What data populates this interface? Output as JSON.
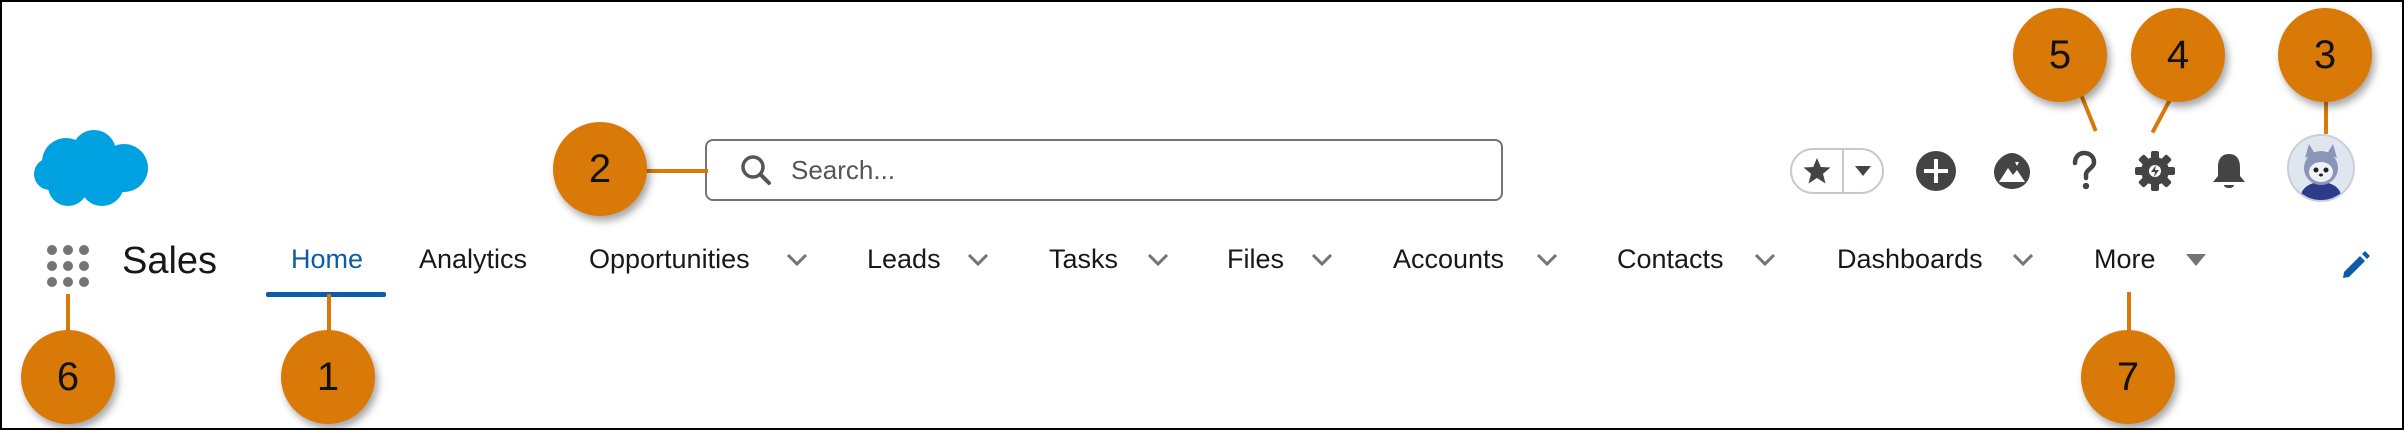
{
  "header": {
    "search_placeholder": "Search...",
    "icons": [
      "salesforce-cloud-logo",
      "search-icon",
      "star-icon",
      "chevron-down-icon",
      "plus-icon",
      "trailhead-icon",
      "help-icon",
      "gear-icon",
      "bell-icon",
      "avatar"
    ]
  },
  "nav": {
    "app_name": "Sales",
    "items": [
      {
        "label": "Home",
        "active": true,
        "has_menu": false
      },
      {
        "label": "Analytics",
        "has_menu": false
      },
      {
        "label": "Opportunities",
        "has_menu": true
      },
      {
        "label": "Leads",
        "has_menu": true
      },
      {
        "label": "Tasks",
        "has_menu": true
      },
      {
        "label": "Files",
        "has_menu": true
      },
      {
        "label": "Accounts",
        "has_menu": true
      },
      {
        "label": "Contacts",
        "has_menu": true
      },
      {
        "label": "Dashboards",
        "has_menu": true
      }
    ],
    "more_label": "More"
  },
  "callouts": [
    "1",
    "2",
    "3",
    "4",
    "5",
    "6",
    "7"
  ],
  "colors": {
    "callout": "#d97a08",
    "brand_blue": "#0b5cab",
    "logo_blue": "#00a1e0",
    "icon_gray": "#747474"
  }
}
